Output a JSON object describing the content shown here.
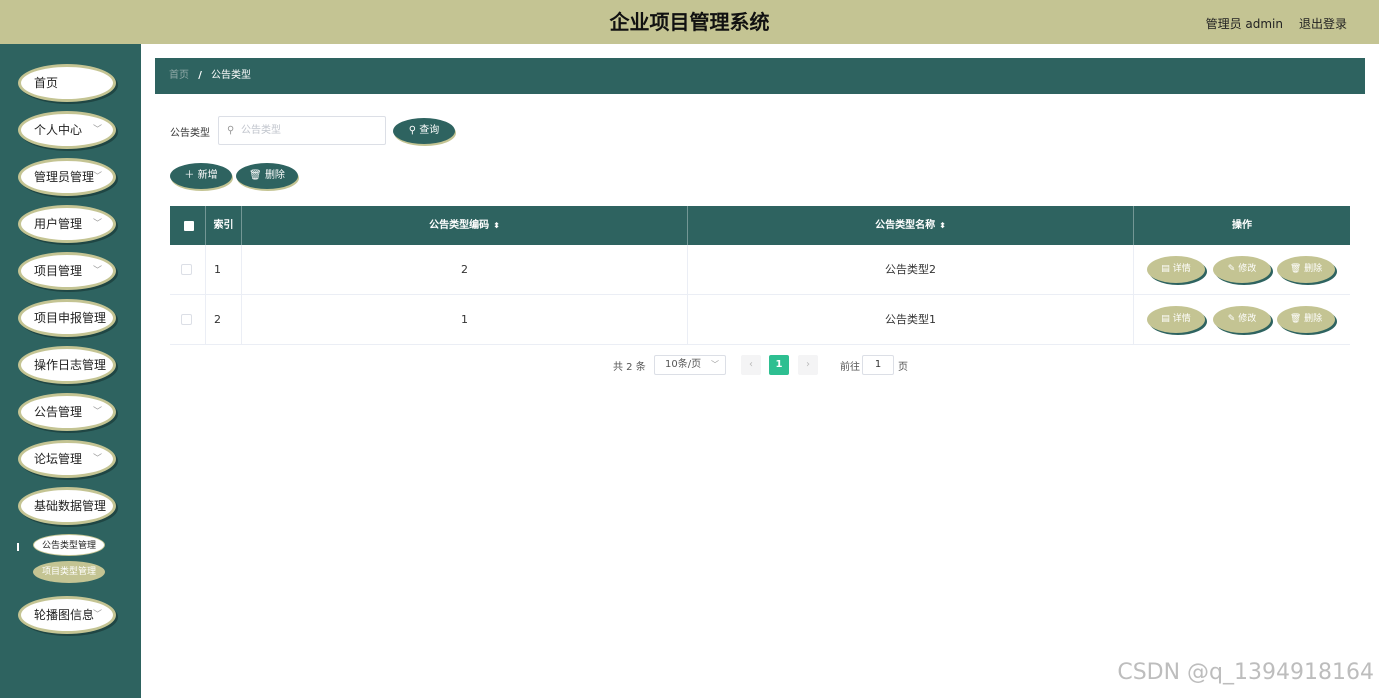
{
  "header": {
    "title": "企业项目管理系统",
    "user": "管理员 admin",
    "logout": "退出登录"
  },
  "sidebar": {
    "items": [
      {
        "label": "首页",
        "has_arrow": false
      },
      {
        "label": "个人中心",
        "has_arrow": true
      },
      {
        "label": "管理员管理",
        "has_arrow": true
      },
      {
        "label": "用户管理",
        "has_arrow": true
      },
      {
        "label": "项目管理",
        "has_arrow": true
      },
      {
        "label": "项目申报管理",
        "has_arrow": false
      },
      {
        "label": "操作日志管理",
        "has_arrow": false
      },
      {
        "label": "公告管理",
        "has_arrow": true
      },
      {
        "label": "论坛管理",
        "has_arrow": true
      },
      {
        "label": "基础数据管理",
        "has_arrow": false
      },
      {
        "label": "轮播图信息",
        "has_arrow": true
      }
    ],
    "subitems": [
      {
        "label": "公告类型管理",
        "active": true
      },
      {
        "label": "项目类型管理",
        "active": false
      }
    ]
  },
  "breadcrumb": {
    "home": "首页",
    "separator": "/",
    "current": "公告类型"
  },
  "search": {
    "label": "公告类型",
    "placeholder": "公告类型",
    "button": "查询"
  },
  "actions": {
    "add": "新增",
    "delete": "删除"
  },
  "table": {
    "columns": [
      "索引",
      "公告类型编码",
      "公告类型名称",
      "操作"
    ],
    "rows": [
      {
        "index": "1",
        "code": "2",
        "name": "公告类型2"
      },
      {
        "index": "2",
        "code": "1",
        "name": "公告类型1"
      }
    ],
    "row_actions": [
      "详情",
      "修改",
      "删除"
    ]
  },
  "pagination": {
    "total": "共 2 条",
    "page_size": "10条/页",
    "current_page": "1",
    "goto_label": "前往",
    "goto_value": "1",
    "goto_suffix": "页"
  },
  "watermark": "CSDN @q_1394918164",
  "colors": {
    "primary": "#2e6360",
    "accent": "#c4c493",
    "active_page": "#2ebf91"
  }
}
